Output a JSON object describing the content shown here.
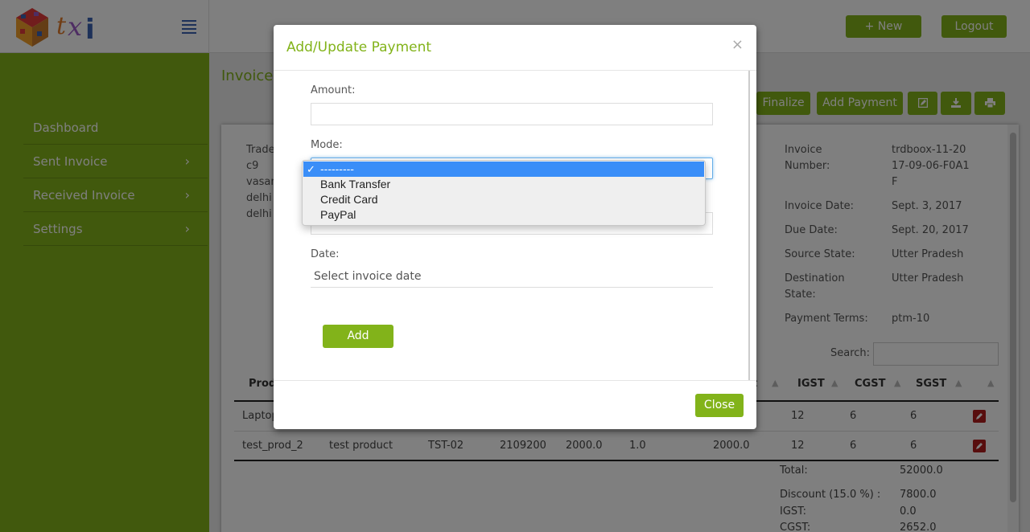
{
  "header": {
    "new_label": "+ New",
    "logout_label": "Logout"
  },
  "sidebar": {
    "items": [
      {
        "label": "Dashboard",
        "chevron": false
      },
      {
        "label": "Sent Invoice",
        "chevron": true
      },
      {
        "label": "Received Invoice",
        "chevron": true
      },
      {
        "label": "Settings",
        "chevron": true
      }
    ]
  },
  "page": {
    "title_partial": "Invoice I",
    "actions": {
      "finalize": "Finalize",
      "add_payment": "Add Payment"
    },
    "address_lines": [
      "Trade",
      "c9",
      "vasan",
      "delhi",
      "delhi"
    ],
    "invoice_info": [
      {
        "label": "Invoice Number:",
        "value": "trdboox-11-2017-09-06-F0A1F"
      },
      {
        "label": "Invoice Date:",
        "value": "Sept. 3, 2017"
      },
      {
        "label": "Due Date:",
        "value": "Sept. 20, 2017"
      },
      {
        "label": "Source State:",
        "value": "Utter Pradesh"
      },
      {
        "label": "Destination State:",
        "value": "Utter Pradesh"
      },
      {
        "label": "Payment Terms:",
        "value": "ptm-10"
      }
    ],
    "search_label": "Search:",
    "table": {
      "headers": [
        "Produ",
        "t",
        "IGST",
        "CGST",
        "SGST"
      ],
      "rows": [
        {
          "product": "Laptop",
          "description": "",
          "code": "",
          "hsn": "",
          "rate": "",
          "qty": "",
          "amount": "",
          "igst": "12",
          "cgst": "6",
          "sgst": "6"
        },
        {
          "product": "test_prod_2",
          "description": "test product",
          "code": "TST-02",
          "hsn": "2109200",
          "rate": "2000.0",
          "qty": "1.0",
          "amount": "2000.0",
          "igst": "12",
          "cgst": "6",
          "sgst": "6"
        }
      ]
    },
    "totals": [
      {
        "label": "Total:",
        "value": "52000.0"
      },
      {
        "label": "Discount (15.0 %) :",
        "value": "7800.0"
      },
      {
        "label": "IGST:",
        "value": "0.0"
      },
      {
        "label": "CGST:",
        "value": "2652.0"
      }
    ]
  },
  "modal": {
    "title": "Add/Update Payment",
    "close_x": "×",
    "amount_label": "Amount:",
    "amount_value": "",
    "mode_label": "Mode:",
    "mode_options": [
      "---------",
      "Bank Transfer",
      "Credit Card",
      "PayPal"
    ],
    "mode_selected_index": 0,
    "date_label": "Date:",
    "date_placeholder": "Select invoice date",
    "add_label": "Add",
    "close_label": "Close"
  },
  "colors": {
    "accent": "#82b31a",
    "select_highlight": "#3a8ef8",
    "edit_icon": "#b01c1c"
  },
  "icons": {
    "menu": "hamburger-icon",
    "edit": "edit-icon",
    "download": "download-icon",
    "print": "print-icon",
    "row_edit": "pencil-icon",
    "chevron": "chevron-right-icon",
    "sort": "sort-icon",
    "check": "checkmark-icon"
  }
}
